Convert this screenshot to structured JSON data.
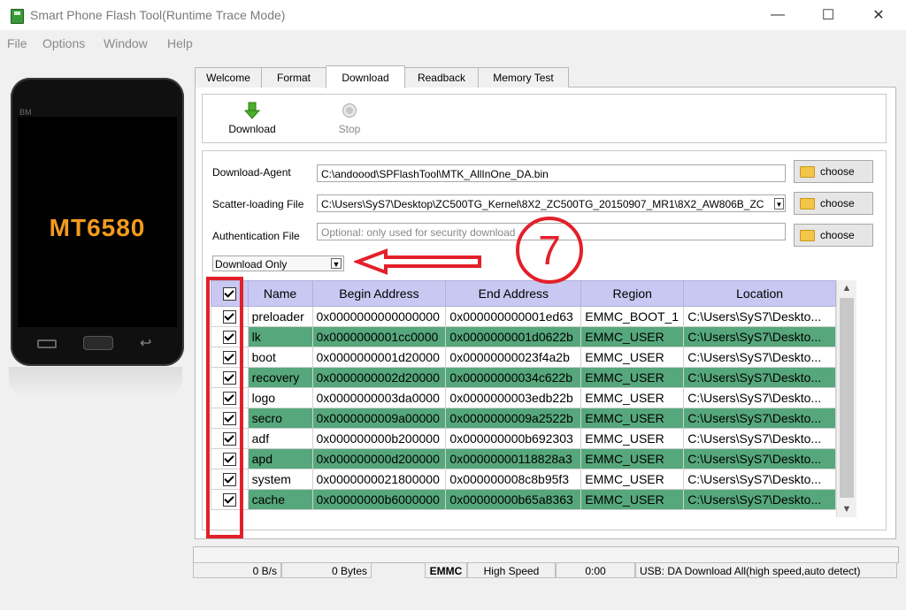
{
  "window": {
    "title": "Smart Phone Flash Tool(Runtime Trace Mode)"
  },
  "menu": [
    "File",
    "Options",
    "Window",
    "Help"
  ],
  "phone": {
    "brand": "BM",
    "chip": "MT6580"
  },
  "tabs": [
    "Welcome",
    "Format",
    "Download",
    "Readback",
    "Memory Test"
  ],
  "toolbar": {
    "download_label": "Download",
    "stop_label": "Stop"
  },
  "form": {
    "download_agent_label": "Download-Agent",
    "download_agent_value": "C:\\andoood\\SPFlashTool\\MTK_AllInOne_DA.bin",
    "scatter_label": "Scatter-loading File",
    "scatter_value": "C:\\Users\\SyS7\\Desktop\\ZC500TG_Kernel\\8X2_ZC500TG_20150907_MR1\\8X2_AW806B_ZC",
    "auth_label": "Authentication File",
    "auth_placeholder": "Optional: only used for security download",
    "choose_label": "choose",
    "mode_value": "Download Only"
  },
  "annotation": {
    "step": "7",
    "accent": "#e3202a"
  },
  "table": {
    "headers": [
      "Name",
      "Begin Address",
      "End Address",
      "Region",
      "Location"
    ],
    "rows": [
      {
        "name": "preloader",
        "begin": "0x0000000000000000",
        "end": "0x000000000001ed63",
        "region": "EMMC_BOOT_1",
        "location": "C:\\Users\\SyS7\\Deskto..."
      },
      {
        "name": "lk",
        "begin": "0x0000000001cc0000",
        "end": "0x0000000001d0622b",
        "region": "EMMC_USER",
        "location": "C:\\Users\\SyS7\\Deskto..."
      },
      {
        "name": "boot",
        "begin": "0x0000000001d20000",
        "end": "0x00000000023f4a2b",
        "region": "EMMC_USER",
        "location": "C:\\Users\\SyS7\\Deskto..."
      },
      {
        "name": "recovery",
        "begin": "0x0000000002d20000",
        "end": "0x00000000034c622b",
        "region": "EMMC_USER",
        "location": "C:\\Users\\SyS7\\Deskto..."
      },
      {
        "name": "logo",
        "begin": "0x0000000003da0000",
        "end": "0x0000000003edb22b",
        "region": "EMMC_USER",
        "location": "C:\\Users\\SyS7\\Deskto..."
      },
      {
        "name": "secro",
        "begin": "0x0000000009a00000",
        "end": "0x0000000009a2522b",
        "region": "EMMC_USER",
        "location": "C:\\Users\\SyS7\\Deskto..."
      },
      {
        "name": "adf",
        "begin": "0x000000000b200000",
        "end": "0x000000000b692303",
        "region": "EMMC_USER",
        "location": "C:\\Users\\SyS7\\Deskto..."
      },
      {
        "name": "apd",
        "begin": "0x000000000d200000",
        "end": "0x00000000118828a3",
        "region": "EMMC_USER",
        "location": "C:\\Users\\SyS7\\Deskto..."
      },
      {
        "name": "system",
        "begin": "0x0000000021800000",
        "end": "0x000000008c8b95f3",
        "region": "EMMC_USER",
        "location": "C:\\Users\\SyS7\\Deskto..."
      },
      {
        "name": "cache",
        "begin": "0x00000000b6000000",
        "end": "0x00000000b65a8363",
        "region": "EMMC_USER",
        "location": "C:\\Users\\SyS7\\Deskto..."
      }
    ]
  },
  "status": {
    "speed": "0 B/s",
    "bytes": "0 Bytes",
    "storage": "EMMC",
    "mode": "High Speed",
    "time": "0:00",
    "usb": "USB: DA Download All(high speed,auto detect)"
  },
  "colors": {
    "row_highlight": "#56a87c",
    "header_bg": "#c8c8f2",
    "chip_text": "#f39b1f"
  }
}
